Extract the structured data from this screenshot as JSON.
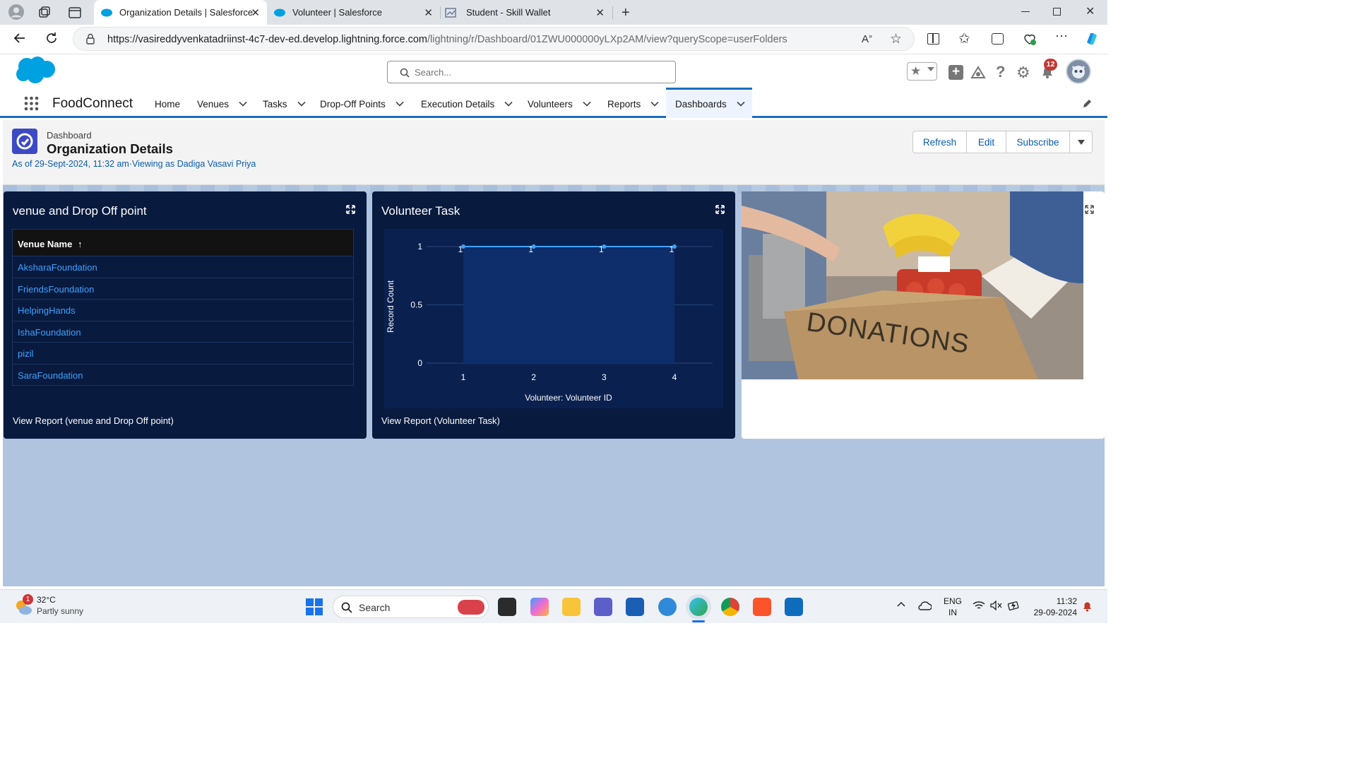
{
  "browser": {
    "tabs": [
      {
        "title": "Organization Details | Salesforce",
        "active": true
      },
      {
        "title": "Volunteer | Salesforce",
        "active": false
      },
      {
        "title": "Student - Skill Wallet",
        "active": false
      }
    ],
    "url_host": "https://vasireddyvenkatadriinst-4c7-dev-ed.develop.lightning.force.com",
    "url_path": "/lightning/r/Dashboard/01ZWU000000yLXp2AM/view?queryScope=userFolders"
  },
  "sf_header": {
    "search_placeholder": "Search...",
    "notification_count": "12"
  },
  "nav": {
    "app_name": "FoodConnect",
    "items": [
      {
        "label": "Home",
        "has_menu": false
      },
      {
        "label": "Venues",
        "has_menu": true
      },
      {
        "label": "Tasks",
        "has_menu": true
      },
      {
        "label": "Drop-Off Points",
        "has_menu": true
      },
      {
        "label": "Execution Details",
        "has_menu": true
      },
      {
        "label": "Volunteers",
        "has_menu": true
      },
      {
        "label": "Reports",
        "has_menu": true
      },
      {
        "label": "Dashboards",
        "has_menu": true,
        "active": true
      }
    ]
  },
  "page": {
    "object_label": "Dashboard",
    "title": "Organization Details",
    "subtitle": "As of 29-Sept-2024, 11:32 am·Viewing as Dadiga Vasavi Priya",
    "buttons": {
      "refresh": "Refresh",
      "edit": "Edit",
      "subscribe": "Subscribe"
    }
  },
  "widgets": {
    "venue": {
      "title": "venue and Drop Off point",
      "column_header": "Venue Name",
      "rows": [
        "AksharaFoundation",
        "FriendsFoundation",
        "HelpingHands",
        "IshaFoundation",
        "pizil",
        "SaraFoundation"
      ],
      "footer": "View Report (venue and Drop Off point)"
    },
    "volunteer": {
      "title": "Volunteer Task",
      "footer": "View Report (Volunteer Task)"
    },
    "image": {
      "caption": "DONATIONS"
    }
  },
  "chart_data": {
    "type": "area",
    "x": [
      "1",
      "2",
      "3",
      "4"
    ],
    "series": [
      {
        "values": [
          1,
          1,
          1,
          1
        ]
      }
    ],
    "data_labels": [
      "1",
      "1",
      "1",
      "1"
    ],
    "xlabel": "Volunteer: Volunteer ID",
    "ylabel": "Record Count",
    "y_ticks": [
      "1",
      "0.5",
      "0"
    ],
    "ylim": [
      0,
      1
    ],
    "grid": true,
    "colors": {
      "line": "#3ea1ff",
      "fill": "#0e2f6c"
    }
  },
  "taskbar": {
    "weather_temp": "32°C",
    "weather_desc": "Partly sunny",
    "weather_badge": "1",
    "search_label": "Search",
    "lang_line1": "ENG",
    "lang_line2": "IN",
    "time": "11:32",
    "date": "29-09-2024"
  }
}
